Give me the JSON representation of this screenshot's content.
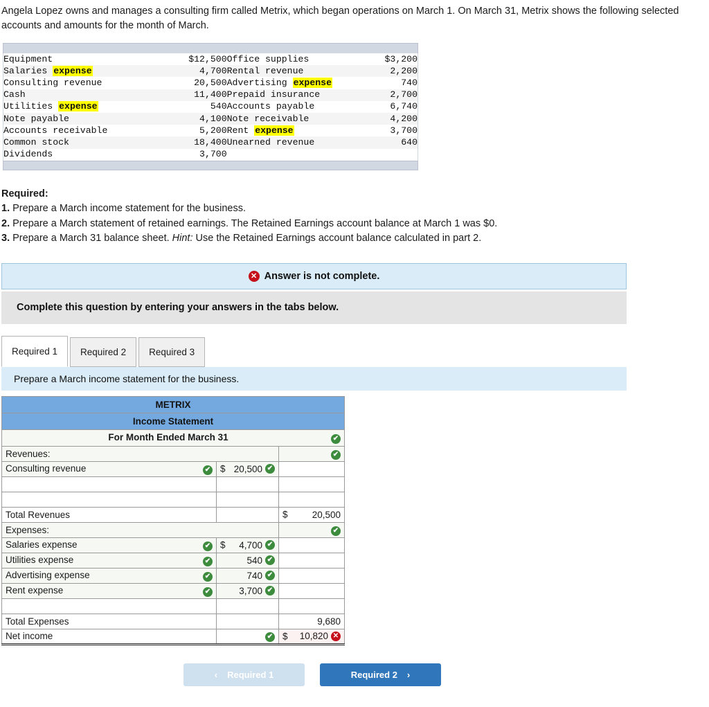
{
  "intro": "Angela Lopez owns and manages a consulting firm called Metrix, which began operations on March 1. On March 31, Metrix shows the following selected accounts and amounts for the month of March.",
  "accounts": {
    "rows": [
      {
        "name_a": "Equipment",
        "hl_a": "",
        "val_a": "$12,500",
        "name_b": "Office supplies",
        "hl_b": "",
        "val_b": "$3,200"
      },
      {
        "name_a": "Salaries ",
        "hl_a": "expense",
        "val_a": "4,700",
        "name_b": "Rental revenue",
        "hl_b": "",
        "val_b": "2,200"
      },
      {
        "name_a": "Consulting revenue",
        "hl_a": "",
        "val_a": "20,500",
        "name_b": "Advertising ",
        "hl_b": "expense",
        "val_b": "740"
      },
      {
        "name_a": "Cash",
        "hl_a": "",
        "val_a": "11,400",
        "name_b": "Prepaid insurance",
        "hl_b": "",
        "val_b": "2,700"
      },
      {
        "name_a": "Utilities ",
        "hl_a": "expense",
        "val_a": "540",
        "name_b": "Accounts payable",
        "hl_b": "",
        "val_b": "6,740"
      },
      {
        "name_a": "Note payable",
        "hl_a": "",
        "val_a": "4,100",
        "name_b": "Note receivable",
        "hl_b": "",
        "val_b": "4,200"
      },
      {
        "name_a": "Accounts receivable",
        "hl_a": "",
        "val_a": "5,200",
        "name_b": "Rent ",
        "hl_b": "expense",
        "val_b": "3,700"
      },
      {
        "name_a": "Common stock",
        "hl_a": "",
        "val_a": "18,400",
        "name_b": "Unearned revenue",
        "hl_b": "",
        "val_b": "640"
      },
      {
        "name_a": "Dividends",
        "hl_a": "",
        "val_a": "3,700",
        "name_b": "",
        "hl_b": "",
        "val_b": ""
      }
    ]
  },
  "required": {
    "heading": "Required:",
    "items": [
      {
        "num": "1.",
        "text": "Prepare a March income statement for the business.",
        "hint": "",
        "tail": ""
      },
      {
        "num": "2.",
        "text": "Prepare a March statement of retained earnings. The Retained Earnings account balance at March 1 was $0.",
        "hint": "",
        "tail": ""
      },
      {
        "num": "3.",
        "text": "Prepare a March 31 balance sheet. ",
        "hint": "Hint:",
        "tail": " Use the Retained Earnings account balance calculated in part 2."
      }
    ]
  },
  "alerts": {
    "incomplete": "Answer is not complete.",
    "incomplete_icon": "x-circle-icon",
    "instruction": "Complete this question by entering your answers in the tabs below."
  },
  "tabs": {
    "items": [
      {
        "label": "Required 1",
        "active": true
      },
      {
        "label": "Required 2",
        "active": false
      },
      {
        "label": "Required 3",
        "active": false
      }
    ],
    "description": "Prepare a March income statement for the business."
  },
  "statement": {
    "company": "METRIX",
    "title": "Income Statement",
    "period": "For Month Ended March 31",
    "revenues_label": "Revenues:",
    "expenses_label": "Expenses:",
    "total_revenues_label": "Total Revenues",
    "total_revenues_value": "20,500",
    "total_revenues_dollar": "$",
    "total_expenses_label": "Total Expenses",
    "total_expenses_value": "9,680",
    "net_income_label": "Net income",
    "net_income_value": "10,820",
    "net_income_dollar": "$",
    "revenue_lines": [
      {
        "label": "Consulting revenue",
        "dollar": "$",
        "value": "20,500",
        "label_mark": "ok",
        "value_mark": "ok"
      },
      {
        "label": "",
        "dollar": "",
        "value": "",
        "label_mark": "",
        "value_mark": ""
      },
      {
        "label": "",
        "dollar": "",
        "value": "",
        "label_mark": "",
        "value_mark": ""
      }
    ],
    "expense_lines": [
      {
        "label": "Salaries expense",
        "dollar": "$",
        "value": "4,700",
        "label_mark": "ok",
        "value_mark": "ok"
      },
      {
        "label": "Utilities expense",
        "dollar": "",
        "value": "540",
        "label_mark": "ok",
        "value_mark": "ok"
      },
      {
        "label": "Advertising expense",
        "dollar": "",
        "value": "740",
        "label_mark": "ok",
        "value_mark": "ok"
      },
      {
        "label": "Rent expense",
        "dollar": "",
        "value": "3,700",
        "label_mark": "ok",
        "value_mark": "ok"
      },
      {
        "label": "",
        "dollar": "",
        "value": "",
        "label_mark": "",
        "value_mark": ""
      }
    ],
    "marks": {
      "ok_glyph": "✔",
      "bad_glyph": "✕"
    }
  },
  "nav": {
    "prev_label": "Required 1",
    "prev_chevron": "‹",
    "next_label": "Required 2",
    "next_chevron": "›"
  },
  "colors": {
    "header_blue": "#74a9e0",
    "alert_blue": "#d9ecf7",
    "ok_green": "#3d8b3d",
    "bad_red": "#c4111b",
    "next_button": "#2f76bb"
  }
}
